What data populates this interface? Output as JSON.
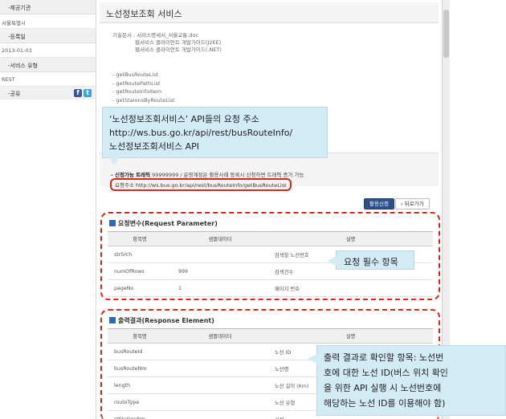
{
  "sidebar": {
    "sections": [
      {
        "label": "-제공기관",
        "value": "서울특별시"
      },
      {
        "label": "-등록일",
        "value": "2013-01-03"
      },
      {
        "label": "-서비스 유형",
        "value": "REST"
      }
    ],
    "share_label": "-공유",
    "sns": [
      {
        "name": "facebook-icon",
        "glyph": "f"
      },
      {
        "name": "twitter-icon",
        "glyph": "t"
      }
    ]
  },
  "main": {
    "title": "노선정보조회 서비스",
    "doc_info": [
      "기술문서 : 서비스명세서_서울교통.doc",
      "웹서비스 클라이언트 개발가이드(J2EE)",
      "웹서비스 클라이언트 개발가이드(.NET)"
    ],
    "operations": [
      "- getBusRouteList",
      "- getRoutePathList",
      "- getRouteInfoItem",
      "- getStaionsByRouteList"
    ],
    "traffic_label": "- 신청가능 트래픽",
    "traffic_text": "99999999 / 운영계정은 활용사례 등록시 신청하면 트래픽 증가 가능",
    "request_url": "요청주소  http://ws.bus.go.kr/api/rest/busRouteInfo/getBusRouteList"
  },
  "buttons": {
    "apply": "활용신청",
    "back": "뒤로가기"
  },
  "request_table": {
    "title": "요청변수(Request Parameter)",
    "headers": [
      "항목명",
      "샘플데이터",
      "설명"
    ],
    "rows": [
      [
        "strSrch",
        "",
        "검색할 노선번호"
      ],
      [
        "numOfRows",
        "999",
        "검색건수"
      ],
      [
        "pageNo",
        "1",
        "페이지 번호"
      ]
    ]
  },
  "response_table": {
    "title": "출력결과(Response Element)",
    "headers": [
      "항목명",
      "샘플데이터",
      "설명"
    ],
    "rows": [
      [
        "busRouteId",
        "",
        "노선 ID"
      ],
      [
        "busRouteNm",
        "",
        "노선명"
      ],
      [
        "length",
        "",
        "노선 길이 (Km)"
      ],
      [
        "routeType",
        "",
        "노선 유형"
      ],
      [
        "stStationNm",
        "",
        "기점"
      ]
    ]
  },
  "callouts": {
    "url_lines": [
      "‘노선정보조회서비스’ API들의 요청 주소",
      "http://ws.bus.go.kr/api/rest/busRouteInfo/",
      "노선정보조회서비스 API"
    ],
    "request": "요청 필수 항목",
    "response_lines": [
      "출력 결과로 확인할 항목: 노선번",
      "호에 대한 노선 ID(버스 위치 확인",
      "을 위한 API 실행 시 노선번호에",
      "해당하는 노선 ID를 이용해야 함)"
    ]
  }
}
